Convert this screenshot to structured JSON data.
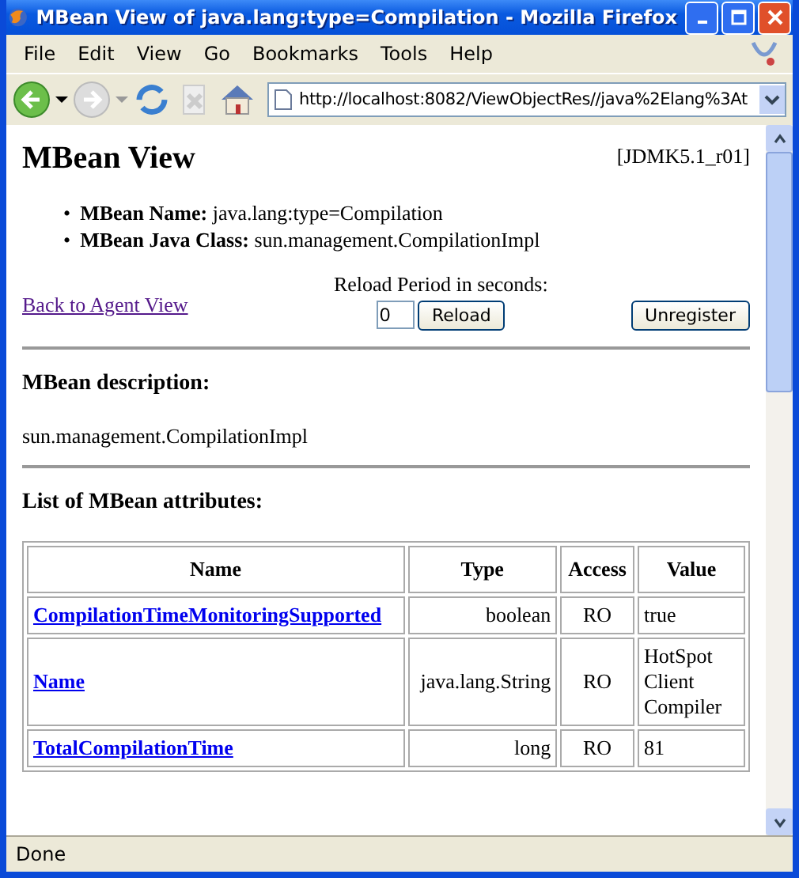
{
  "window": {
    "title": "MBean View of java.lang:type=Compilation - Mozilla Firefox"
  },
  "menu": [
    "File",
    "Edit",
    "View",
    "Go",
    "Bookmarks",
    "Tools",
    "Help"
  ],
  "address_bar": {
    "value": "http://localhost:8082/ViewObjectRes//java%2Elang%3At"
  },
  "page": {
    "heading": "MBean View",
    "version": "[JDMK5.1_r01]",
    "properties": [
      {
        "marker": "•",
        "label": "MBean Name:",
        "value": "java.lang:type=Compilation"
      },
      {
        "marker": "•",
        "label": "MBean Java Class:",
        "value": "sun.management.CompilationImpl"
      }
    ],
    "back_link": "Back to Agent View",
    "reload_label": "Reload Period in seconds:",
    "reload_value": "0",
    "reload_button": "Reload",
    "unregister_button": "Unregister",
    "description_heading": "MBean description:",
    "description": "sun.management.CompilationImpl",
    "attributes_heading": "List of MBean attributes:",
    "table": {
      "columns": [
        "Name",
        "Type",
        "Access",
        "Value"
      ],
      "rows": [
        [
          "CompilationTimeMonitoringSupported",
          "boolean",
          "RO",
          "true"
        ],
        [
          "Name",
          "java.lang.String",
          "RO",
          "HotSpot Client Compiler"
        ],
        [
          "TotalCompilationTime",
          "long",
          "RO",
          "81"
        ]
      ]
    }
  },
  "status_bar": "Done"
}
